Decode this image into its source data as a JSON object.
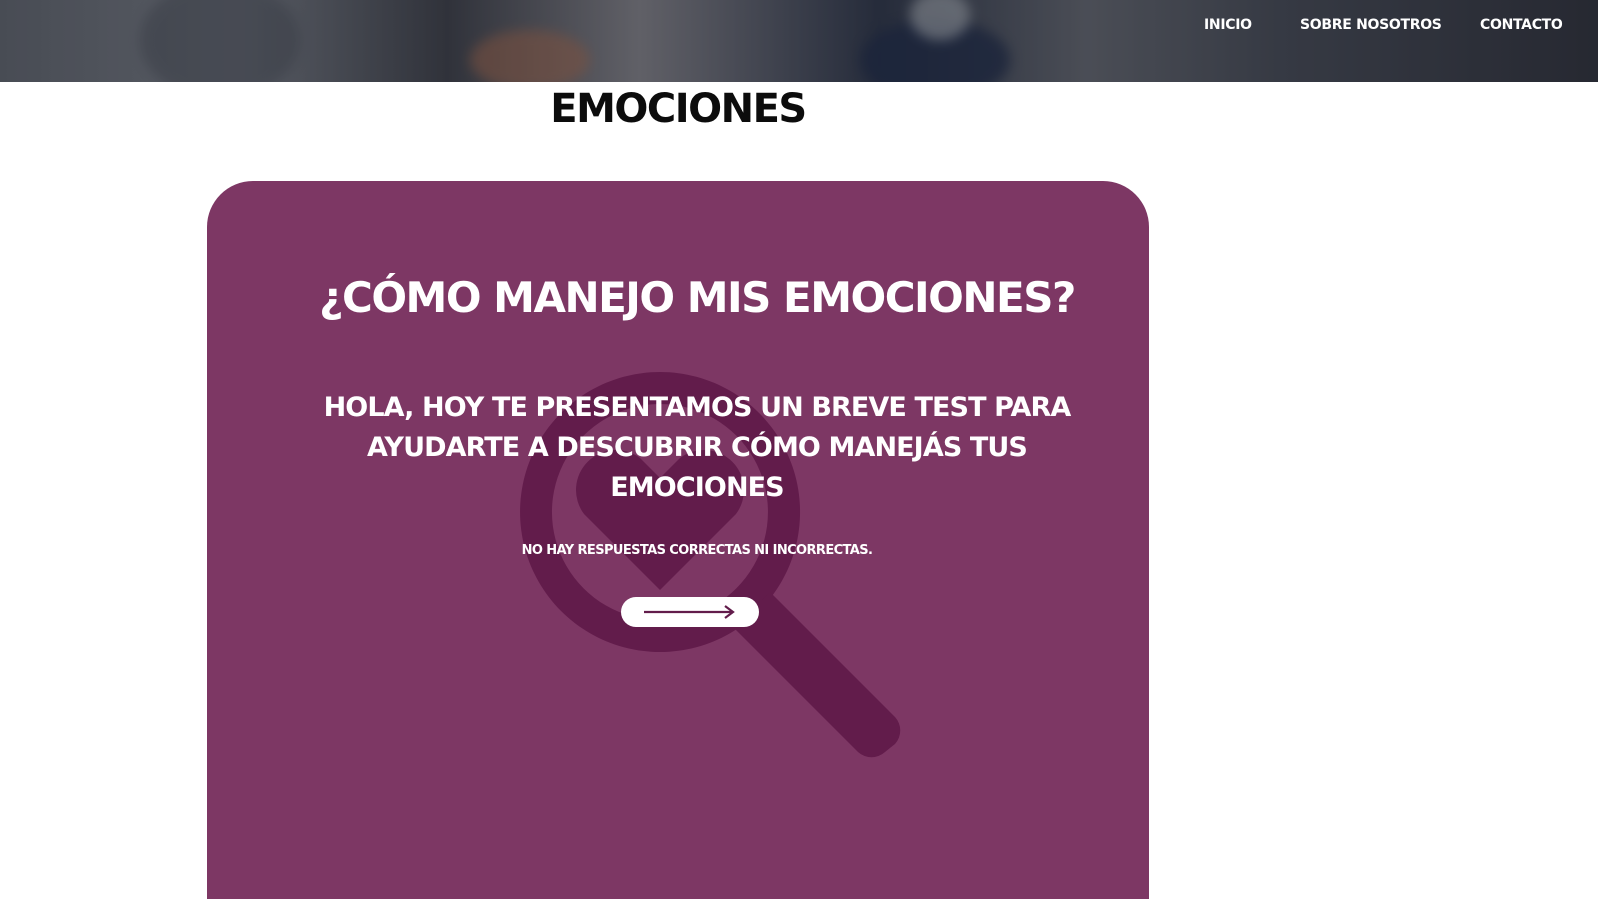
{
  "nav": {
    "items": [
      {
        "label": "INICIO"
      },
      {
        "label": "SOBRE NOSOTROS"
      },
      {
        "label": "CONTACTO"
      }
    ]
  },
  "page": {
    "title": "EMOCIONES"
  },
  "card": {
    "title": "¿CÓMO MANEJO MIS EMOCIONES?",
    "intro": "HOLA, HOY TE PRESENTAMOS UN BREVE TEST PARA AYUDARTE A DESCUBRIR CÓMO MANEJÁS TUS EMOCIONES",
    "note": "NO HAY RESPUESTAS CORRECTAS NI INCORRECTAS.",
    "start_button_icon": "arrow-right-icon",
    "watermark_icon": "magnifier-heart-icon"
  },
  "colors": {
    "card_background": "#7d3764",
    "watermark": "#621c4b",
    "text_dark": "#0c0c0c",
    "text_light": "#ffffff"
  }
}
